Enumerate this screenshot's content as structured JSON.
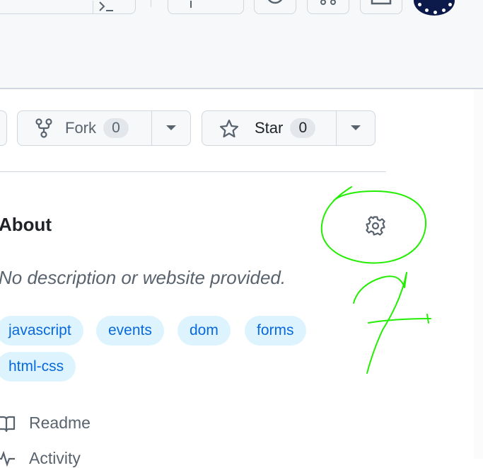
{
  "header": {
    "avatar_icon": "user-avatar"
  },
  "repo_actions": {
    "fork": {
      "label": "Fork",
      "count": "0",
      "icon": "repo-forked-icon"
    },
    "star": {
      "label": "Star",
      "count": "0",
      "icon": "star-icon"
    }
  },
  "about": {
    "title": "About",
    "description": "No description or website provided.",
    "settings_icon": "gear-icon",
    "topics": [
      "javascript",
      "events",
      "dom",
      "forms",
      "html-css"
    ],
    "links": [
      {
        "label": "Readme",
        "icon": "book-icon"
      },
      {
        "label": "Activity",
        "icon": "pulse-icon"
      }
    ]
  },
  "annotation": {
    "color": "#22ee00",
    "shapes": [
      "circle-around-gear",
      "number-7-scribble"
    ]
  },
  "colors": {
    "accent_link": "#0969da",
    "topic_bg": "#ddf4ff",
    "border": "#d0d7de"
  }
}
